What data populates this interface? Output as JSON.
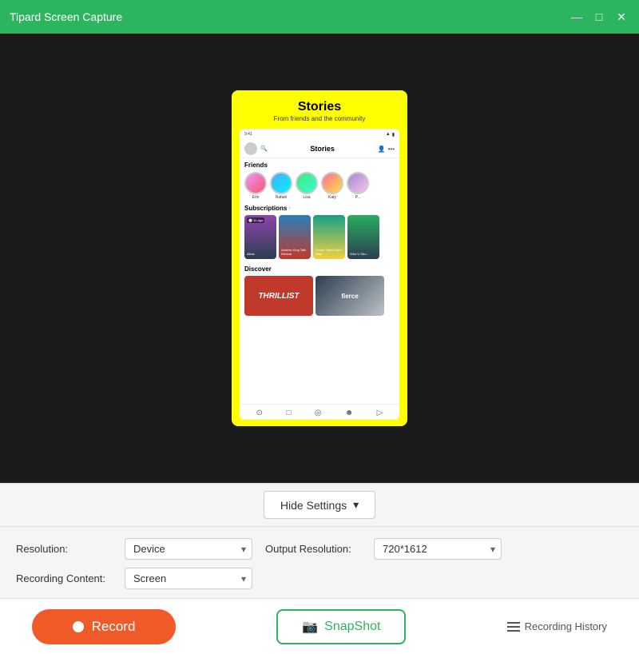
{
  "titleBar": {
    "title": "Tipard Screen Capture",
    "minimizeBtn": "—",
    "maximizeBtn": "□",
    "closeBtn": "✕"
  },
  "phonePreview": {
    "storiesTitle": "Stories",
    "storiesSubtitle": "From friends and the community",
    "headerTitle": "Stories",
    "friends": [
      {
        "name": "Erin"
      },
      {
        "name": "Rafael"
      },
      {
        "name": "Lisa"
      },
      {
        "name": "Katy"
      },
      {
        "name": "P..."
      }
    ],
    "subscriptionsLabel": "Subscriptions",
    "discoverLabel": "Discover",
    "subCards": [
      {
        "label": "Alicia"
      },
      {
        "label": "Andrew King Talk Revival"
      },
      {
        "label": "Seven Facts\nDidn't Stop Me Dream"
      },
      {
        "label": "Who U\nSho Thi..."
      }
    ],
    "navIcons": [
      "⊙",
      "□",
      "◎",
      "☻",
      "▷"
    ]
  },
  "hideSettings": {
    "label": "Hide Settings",
    "chevron": "▾"
  },
  "settings": {
    "resolutionLabel": "Resolution:",
    "resolutionValue": "Device",
    "outputResolutionLabel": "Output Resolution:",
    "outputResolutionValue": "720*1612",
    "recordingContentLabel": "Recording Content:",
    "recordingContentValue": "Screen"
  },
  "actions": {
    "recordLabel": "Record",
    "snapshotLabel": "SnapShot",
    "recordingHistoryLabel": "Recording History"
  }
}
